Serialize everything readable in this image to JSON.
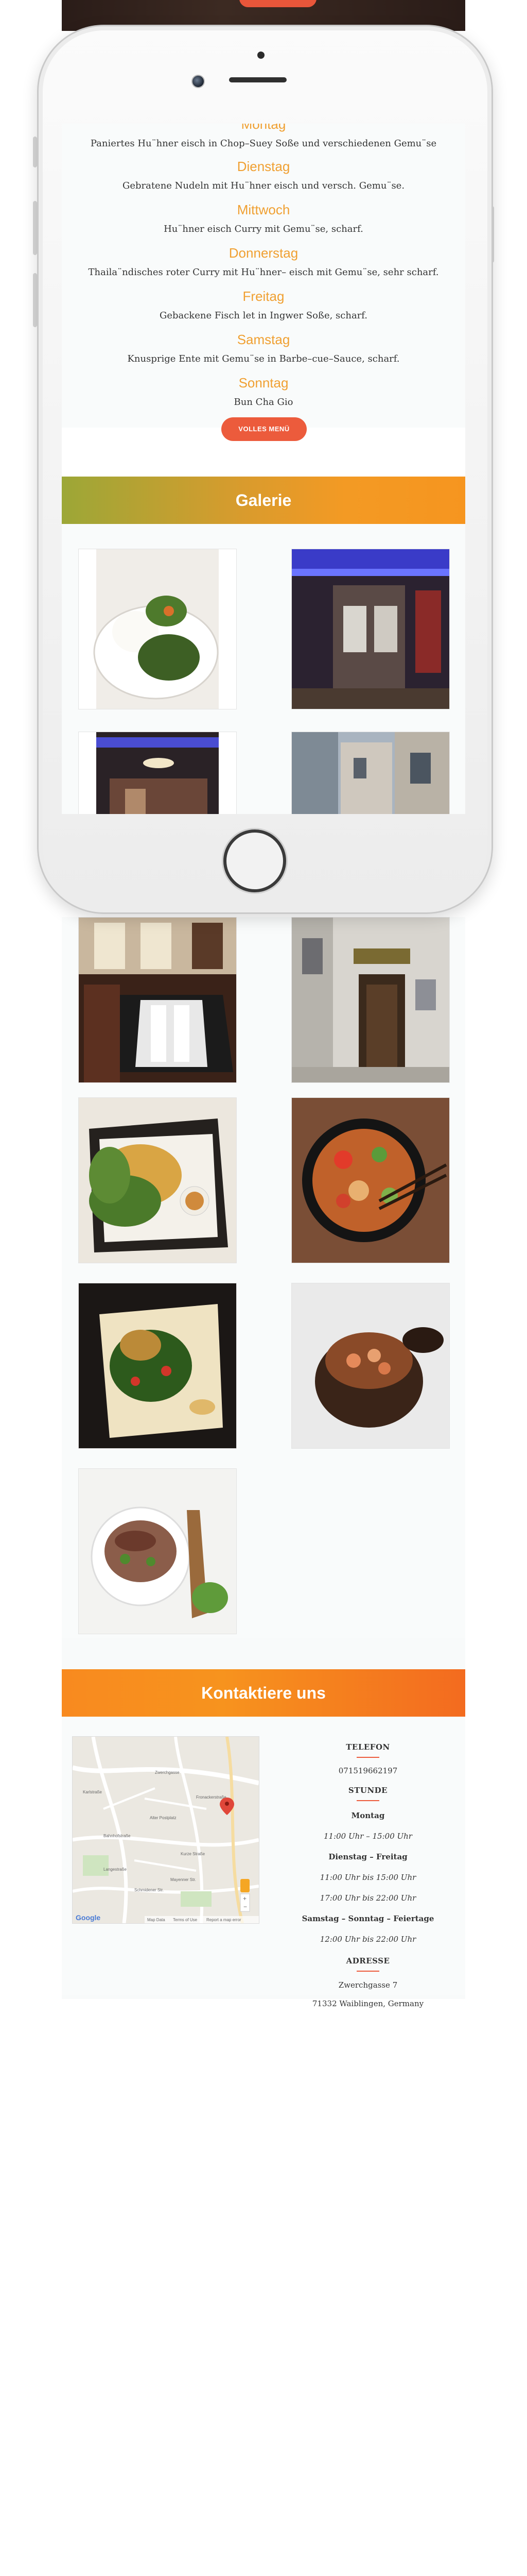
{
  "menu": {
    "items": [
      {
        "text": "Paniertes Hu¨hner eisch in Chop–Suey Soße und verschiedenen Gemu¨se"
      },
      {
        "day": "Dienstag",
        "text": "Gebratene Nudeln mit Hu¨hner eisch und versch. Gemu¨se."
      },
      {
        "day": "Mittwoch",
        "text": "Hu¨hner eisch Curry mit Gemu¨se, scharf."
      },
      {
        "day": "Donnerstag",
        "text": "Thaila¨ndisches roter Curry mit Hu¨hner– eisch mit Gemu¨se, sehr scharf."
      },
      {
        "day": "Freitag",
        "text": "Gebackene Fisch let in Ingwer Soße, scharf."
      },
      {
        "day": "Samstag",
        "text": "Knusprige Ente mit Gemu¨se in Barbe–cue–Sauce, scharf."
      },
      {
        "day": "Sonntag",
        "text": "Bun Cha Gio"
      }
    ],
    "button_label": "VOLLES MENÜ"
  },
  "gallery": {
    "title": "Galerie"
  },
  "contact": {
    "title": "Kontaktiere uns",
    "phone_heading": "TELEFON",
    "phone": "071519662197",
    "hours_heading": "STUNDE",
    "monday_label": "Montag",
    "monday_hours": "11:00 Uhr – 15:00 Uhr",
    "tue_fri_label": "Dienstag – Freitag",
    "tue_fri_hours_1": "11:00 Uhr bis 15:00 Uhr",
    "tue_fri_hours_2": "17:00 Uhr bis 22:00 Uhr",
    "weekend_label": "Samstag – Sonntag – Feiertage",
    "weekend_hours": "12:00 Uhr bis 22:00 Uhr",
    "address_heading": "ADRESSE",
    "street": "Zwerchgasse 7",
    "city": "71332 Waiblingen, Germany",
    "map": {
      "streets": [
        "Zwerchgasse",
        "Bahnhofstraße",
        "Alter Postplatz",
        "Fronackerstraße",
        "Langestraße",
        "Kurze Straße",
        "Schmidener Str.",
        "Karlstraße",
        "Mayenner Str."
      ],
      "footer": [
        "Map Data",
        "Terms of Use",
        "Report a map error"
      ],
      "logo": "Google"
    }
  },
  "colors": {
    "accent_orange": "#f0a032",
    "button_red": "#ec5b3c",
    "gallery_banner": "#e19a2a",
    "contact_banner": "#f7911e"
  }
}
